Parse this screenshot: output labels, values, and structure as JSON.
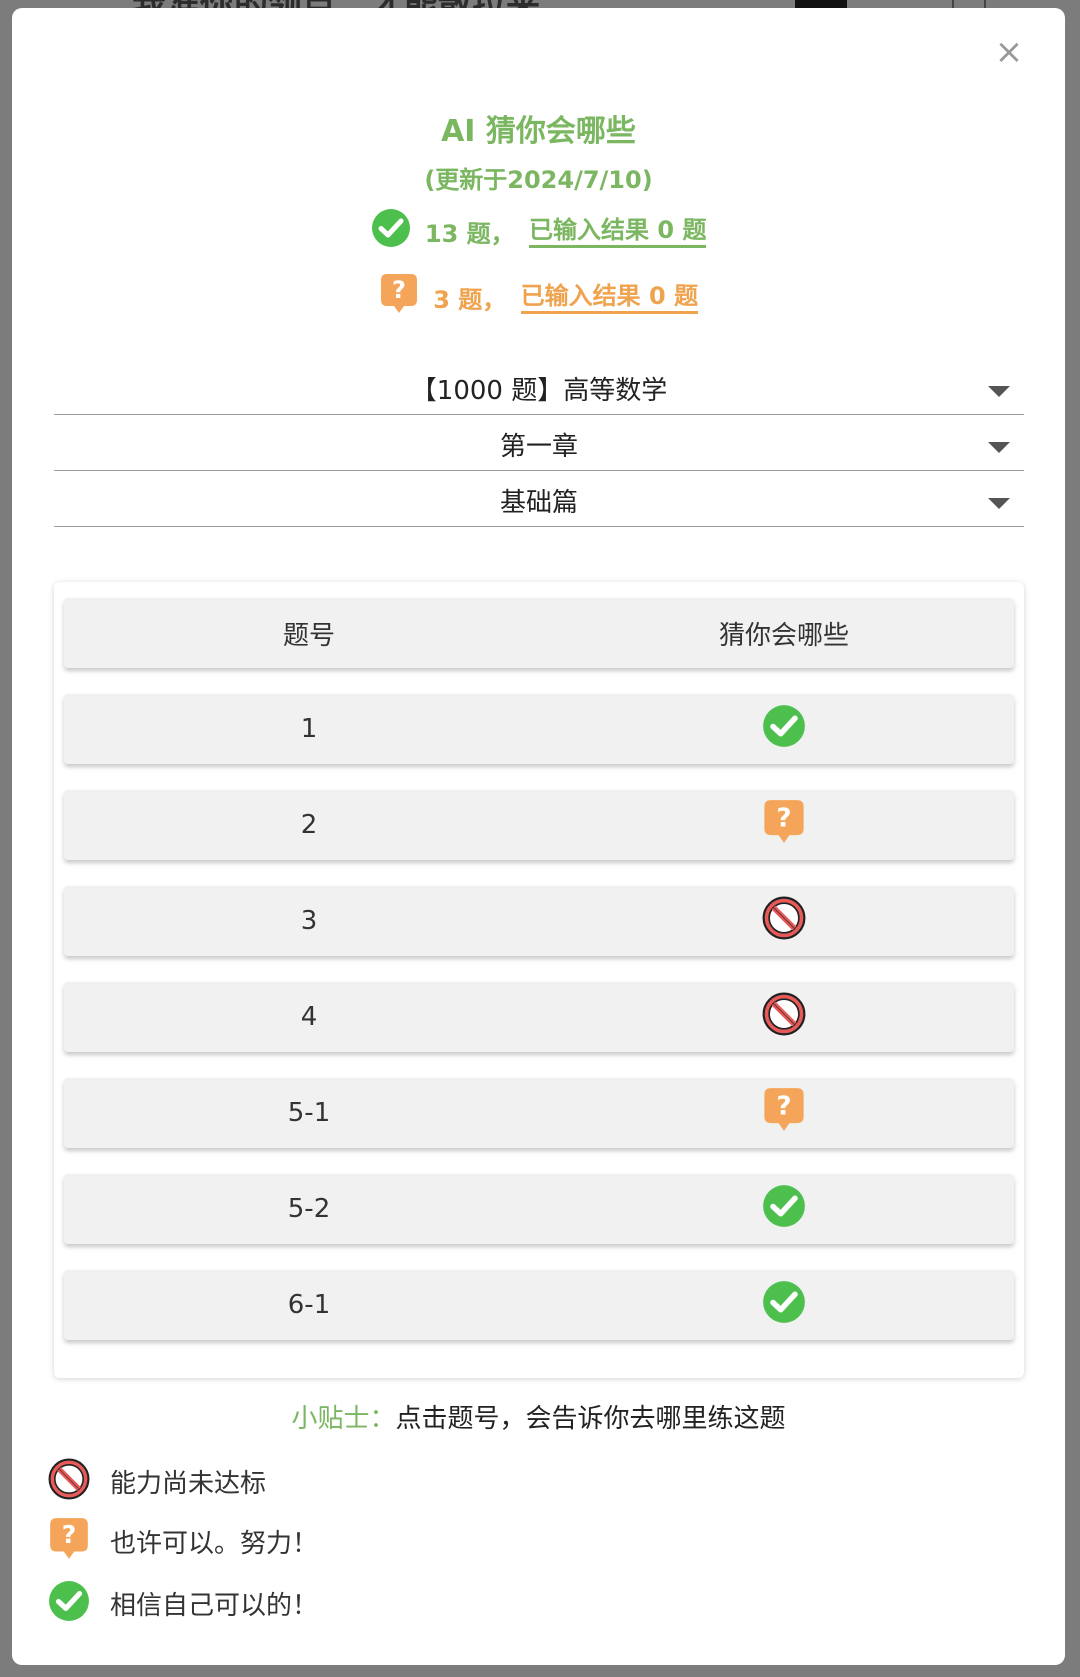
{
  "backdrop": {
    "title": "我准你的领点，才能散拉来"
  },
  "modal": {
    "close_label": "×",
    "title": "AI 猜你会哪些",
    "subtitle": "(更新于2024/7/10)",
    "stats": [
      {
        "icon": "check-circle-icon",
        "count_text": "13 题，",
        "link_text": "已输入结果 0 题",
        "color": "#7bb661"
      },
      {
        "icon": "question-bubble-icon",
        "count_text": "3 题，",
        "link_text": "已输入结果 0 题",
        "color": "#f0a34e"
      }
    ],
    "dropdowns": [
      {
        "label": "【1000 题】高等数学"
      },
      {
        "label": "第一章"
      },
      {
        "label": "基础篇"
      }
    ],
    "table": {
      "headers": [
        "题号",
        "猜你会哪些"
      ],
      "rows": [
        {
          "number": "1",
          "status": "check-circle-icon"
        },
        {
          "number": "2",
          "status": "question-bubble-icon"
        },
        {
          "number": "3",
          "status": "prohibited-icon"
        },
        {
          "number": "4",
          "status": "prohibited-icon"
        },
        {
          "number": "5-1",
          "status": "question-bubble-icon"
        },
        {
          "number": "5-2",
          "status": "check-circle-icon"
        },
        {
          "number": "6-1",
          "status": "check-circle-icon"
        }
      ]
    },
    "tip": {
      "label": "小贴士：",
      "text": "点击题号，会告诉你去哪里练这题"
    },
    "legend": [
      {
        "icon": "prohibited-icon",
        "text": "能力尚未达标"
      },
      {
        "icon": "question-bubble-icon",
        "text": "也许可以。努力！"
      },
      {
        "icon": "check-circle-icon",
        "text": "相信自己可以的！"
      }
    ]
  },
  "colors": {
    "accent_green": "#7bb661",
    "accent_orange": "#f0a34e",
    "check_green": "#4cbf4c",
    "prohibit_red": "#e85a5a"
  }
}
